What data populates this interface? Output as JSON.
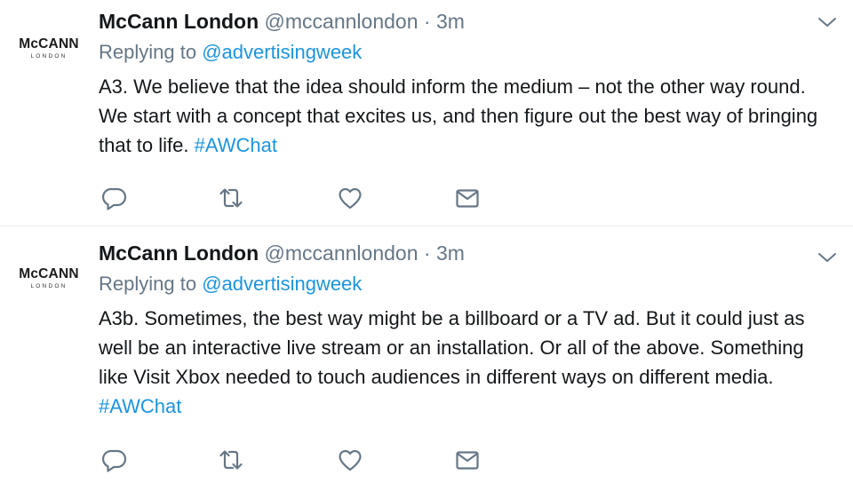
{
  "tweets": [
    {
      "author": {
        "name": "McCann London",
        "handle": "@mccannlondon",
        "avatar_brand": "McCANN",
        "avatar_sub": "LONDON"
      },
      "separator": "·",
      "time": "3m",
      "reply_prefix": "Replying to",
      "reply_to": "@advertisingweek",
      "text": "A3. We believe that the idea should inform the medium – not the other way round. We start with a concept that excites us, and then figure out the best way of bringing that to life.",
      "hashtag": "#AWChat"
    },
    {
      "author": {
        "name": "McCann London",
        "handle": "@mccannlondon",
        "avatar_brand": "McCANN",
        "avatar_sub": "LONDON"
      },
      "separator": "·",
      "time": "3m",
      "reply_prefix": "Replying to",
      "reply_to": "@advertisingweek",
      "text": "A3b. Sometimes, the best way might be a billboard or a TV ad. But it could just as well be an interactive live stream or an installation. Or all of the above. Something like Visit Xbox needed to touch audiences in different ways on different media.",
      "hashtag": "#AWChat"
    }
  ],
  "icons": {
    "reply": "reply-icon",
    "retweet": "retweet-icon",
    "like": "heart-icon",
    "dm": "envelope-icon",
    "menu": "chevron-down-icon"
  },
  "colors": {
    "link": "#1b95e0",
    "muted": "#657786",
    "text": "#14171a",
    "divider": "#e6ecf0"
  }
}
